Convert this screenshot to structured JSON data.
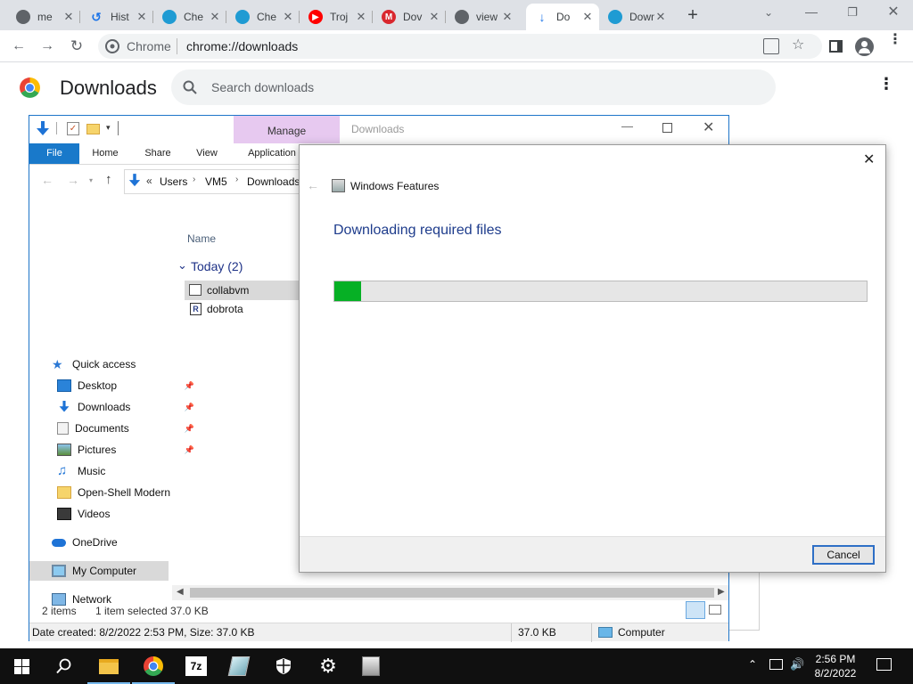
{
  "browser": {
    "tabs": [
      {
        "label": "me",
        "icon": "chrome-icon",
        "color": "#5f6368"
      },
      {
        "label": "Hist",
        "icon": "history-icon",
        "color": "#1a73e8"
      },
      {
        "label": "Che",
        "icon": "globe-icon",
        "color": "#1f9bd3"
      },
      {
        "label": "Che",
        "icon": "globe-icon",
        "color": "#1f9bd3"
      },
      {
        "label": "Troj",
        "icon": "youtube-icon",
        "color": "#ff0000"
      },
      {
        "label": "Dov",
        "icon": "mega-icon",
        "color": "#d9272e"
      },
      {
        "label": "view",
        "icon": "chrome-icon",
        "color": "#5f6368"
      },
      {
        "label": "Do",
        "icon": "download-icon",
        "color": "#1a73e8"
      },
      {
        "label": "Downlo",
        "icon": "globe-icon",
        "color": "#1f9bd3"
      }
    ],
    "address_site": "Chrome",
    "address_url": "chrome://downloads"
  },
  "downloads_page": {
    "title": "Downloads",
    "search_placeholder": "Search downloads"
  },
  "explorer": {
    "title": "Downloads",
    "manage_label": "Manage",
    "ribbon_tabs": [
      "File",
      "Home",
      "Share",
      "View",
      "Application"
    ],
    "breadcrumb": [
      "Users",
      "VM5",
      "Downloads"
    ],
    "breadcrumb_prefix": "«",
    "column_name": "Name",
    "group_label": "Today (2)",
    "files": [
      "collabvm",
      "dobrota"
    ],
    "nav": {
      "quick_access": "Quick access",
      "items": [
        "Desktop",
        "Downloads",
        "Documents",
        "Pictures",
        "Music",
        "Open-Shell Modern",
        "Videos"
      ],
      "onedrive": "OneDrive",
      "my_computer": "My Computer",
      "network": "Network"
    },
    "status_items": "2 items",
    "status_selected": "1 item selected",
    "status_size": "37.0 KB",
    "details_bar_text": "Date created: 8/2/2022 2:53 PM, Size: 37.0 KB",
    "details_bar_size": "37.0 KB",
    "details_bar_location": "Computer"
  },
  "dialog": {
    "title": "Windows Features",
    "heading": "Downloading required files",
    "progress": 0.05,
    "progress_color": "#06b025",
    "cancel_label": "Cancel"
  },
  "taskbar": {
    "time": "2:56 PM",
    "date": "8/2/2022"
  }
}
